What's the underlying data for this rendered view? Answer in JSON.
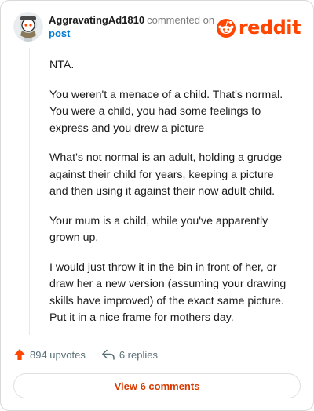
{
  "header": {
    "author": "AggravatingAd1810",
    "commented_text": "commented on",
    "post_link": "post",
    "brand": "reddit"
  },
  "comment": {
    "paragraphs": [
      "NTA.",
      "You weren't a menace of a child. That's normal. You were a child, you had some feelings to express and you drew a picture",
      "What's not normal is an adult, holding a grudge against their child for years, keeping a picture and then using it against their now adult child.",
      "Your mum is a child, while you've apparently grown up.",
      "I would just throw it in the bin in front of her, or draw her a new version (assuming your drawing skills have improved) of the exact same picture. Put it in a nice frame for mothers day."
    ]
  },
  "actions": {
    "upvotes": "894 upvotes",
    "replies": "6 replies"
  },
  "view_comments_label": "View 6 comments",
  "colors": {
    "brand": "#ff4500",
    "link": "#0079d3",
    "button_text": "#d93a00",
    "muted": "#576f76"
  },
  "icons": {
    "avatar": "snoo-avatar",
    "brand": "reddit-snoo-logo-icon",
    "upvote": "upvote-arrow-icon",
    "reply": "reply-arrow-icon"
  }
}
